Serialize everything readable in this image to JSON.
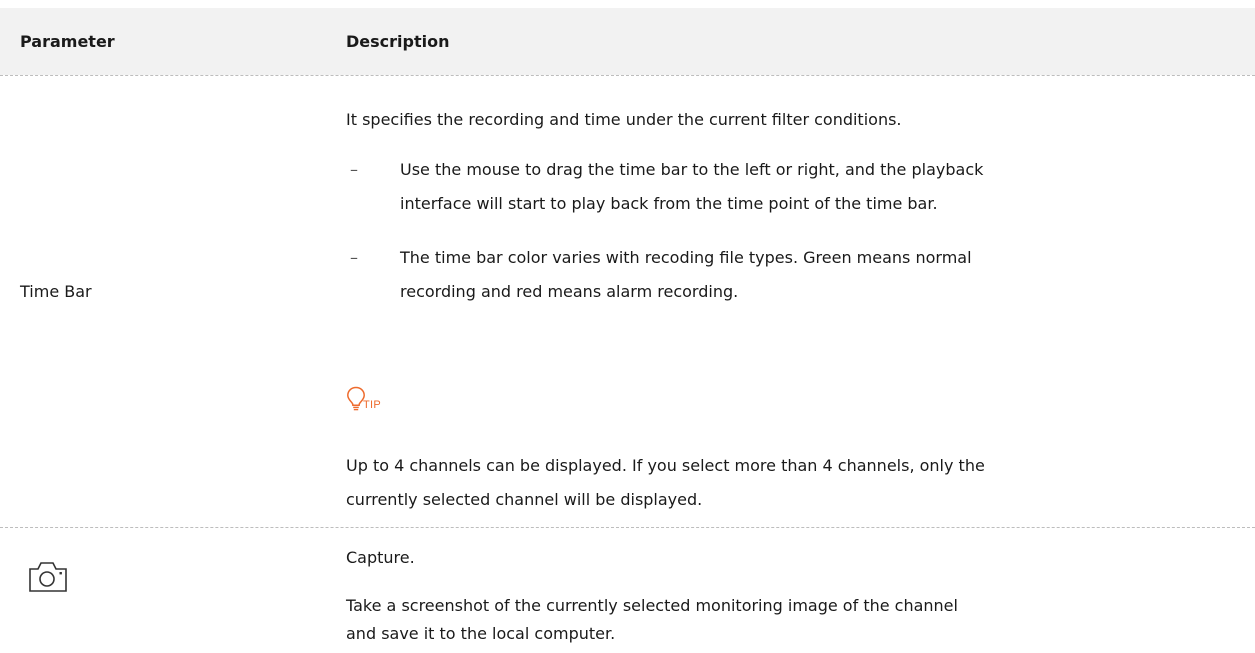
{
  "table": {
    "header": {
      "parameter": "Parameter",
      "description": "Description"
    },
    "rows": [
      {
        "parameter": "Time Bar",
        "intro": "It specifies the recording and time under the current filter conditions.",
        "bullets": [
          {
            "mark": "–",
            "line1": "Use the mouse to drag the time bar to the left or right, and the playback",
            "line2": "interface will start to play back from the time point of the time bar."
          },
          {
            "mark": "–",
            "line1": "The time bar color varies with recoding file types. Green means normal",
            "line2": "recording and red means alarm recording."
          }
        ],
        "tip": {
          "label": "TIP",
          "icon": "lightbulb-icon",
          "line1": "Up to 4 channels can be displayed. If you select more than 4 channels, only the",
          "line2": "currently selected channel will be displayed."
        }
      },
      {
        "icon": "camera-icon",
        "title": "Capture.",
        "line1": "Take a screenshot of the currently selected monitoring image of the channel",
        "line2": "and save it to the local computer."
      }
    ]
  },
  "colors": {
    "tip_accent": "#ee6b2d",
    "header_bg": "#f2f2f2",
    "divider": "#bdbdbd"
  }
}
